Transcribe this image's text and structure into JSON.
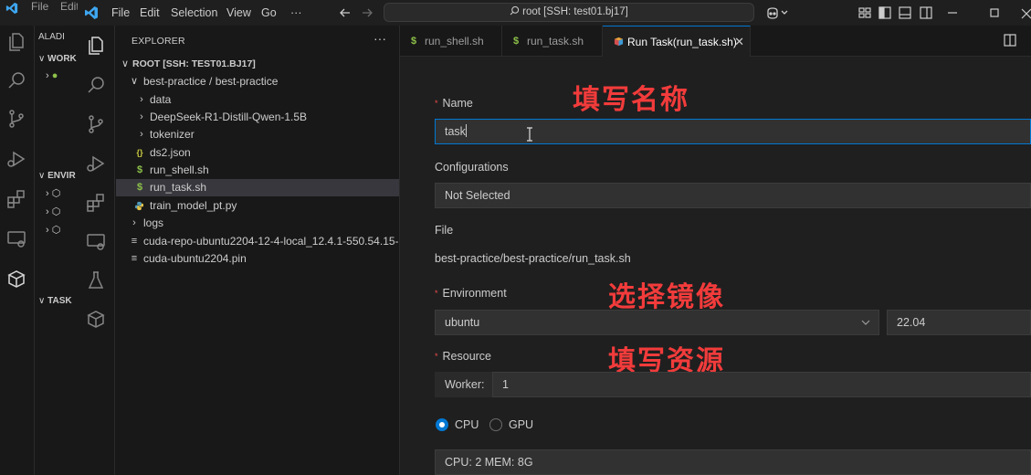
{
  "background_window": {
    "menu": [
      "File",
      "Edit"
    ],
    "sections": {
      "aladdin": "ALADI",
      "workspace": "WORK",
      "environment": "ENVIR",
      "task": "TASK"
    }
  },
  "titlebar": {
    "menu": [
      "File",
      "Edit",
      "Selection",
      "View",
      "Go",
      "···"
    ],
    "command_center": "root [SSH: test01.bj17]"
  },
  "explorer": {
    "title": "EXPLORER",
    "more": "···",
    "root": "ROOT [SSH: TEST01.BJ17]",
    "items": [
      {
        "label": "best-practice / best-practice",
        "icon": "chevron-down-icon",
        "type": "folder"
      },
      {
        "label": "data",
        "icon": "chevron-right-icon",
        "type": "folder"
      },
      {
        "label": "DeepSeek-R1-Distill-Qwen-1.5B",
        "icon": "chevron-right-icon",
        "type": "folder"
      },
      {
        "label": "tokenizer",
        "icon": "chevron-right-icon",
        "type": "folder"
      },
      {
        "label": "ds2.json",
        "icon": "json-file-icon",
        "type": "file"
      },
      {
        "label": "run_shell.sh",
        "icon": "shell-file-icon",
        "type": "file"
      },
      {
        "label": "run_task.sh",
        "icon": "shell-file-icon",
        "type": "file",
        "selected": true
      },
      {
        "label": "train_model_pt.py",
        "icon": "python-file-icon",
        "type": "file"
      },
      {
        "label": "logs",
        "icon": "chevron-right-icon",
        "type": "folder"
      },
      {
        "label": "cuda-repo-ubuntu2204-12-4-local_12.4.1-550.54.15-...",
        "icon": "file-icon",
        "type": "file"
      },
      {
        "label": "cuda-ubuntu2204.pin",
        "icon": "file-icon",
        "type": "file"
      }
    ]
  },
  "tabs": [
    {
      "label": "run_shell.sh",
      "icon": "shell-file-icon"
    },
    {
      "label": "run_task.sh",
      "icon": "shell-file-icon"
    },
    {
      "label": "Run Task(run_task.sh)",
      "icon": "task-icon",
      "active": true,
      "close": "✕"
    }
  ],
  "form": {
    "name_label": "Name",
    "name_value": "task",
    "config_label": "Configurations",
    "config_value": "Not Selected",
    "file_label": "File",
    "file_value": "best-practice/best-practice/run_task.sh",
    "env_label": "Environment",
    "env_os": "ubuntu",
    "env_version": "22.04",
    "resource_label": "Resource",
    "worker_label": "Worker:",
    "worker_value": "1",
    "radio_cpu": "CPU",
    "radio_gpu": "GPU",
    "selected_resource": "cpu",
    "spec_value": "CPU: 2 MEM: 8G",
    "required_mark": "*"
  },
  "annotations": {
    "name": "填写名称",
    "env": "选择镜像",
    "resource": "填写资源"
  },
  "colors": {
    "accent": "#0078d4",
    "annotation": "#f23b3b",
    "shell_icon": "#8dc149",
    "json_icon": "#cbcb41",
    "python_icon": "#519aba"
  }
}
